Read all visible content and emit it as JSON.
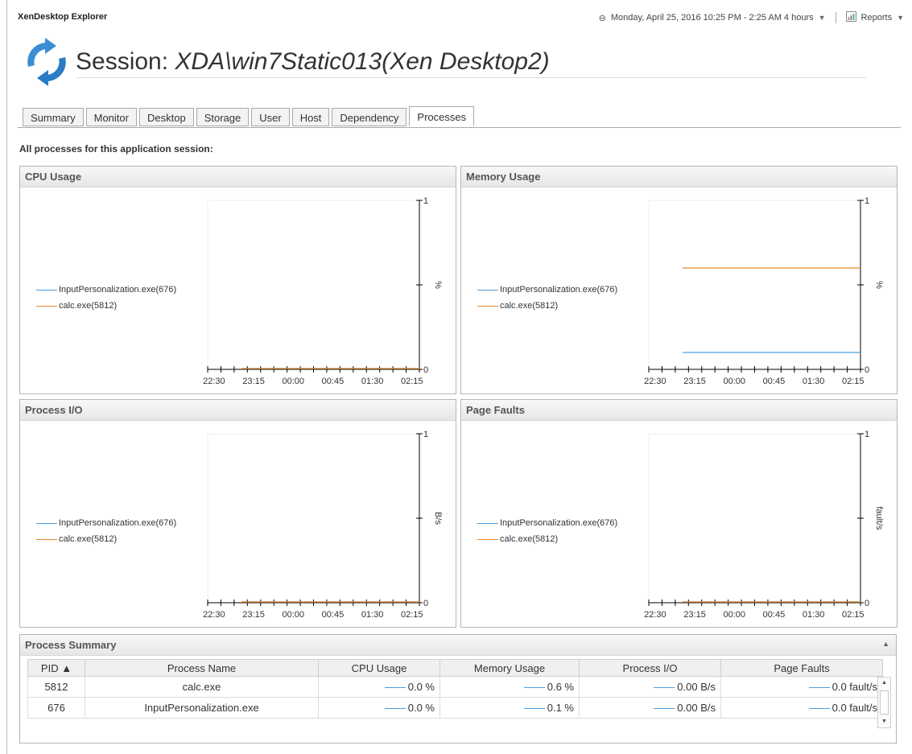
{
  "app": {
    "title": "XenDesktop Explorer"
  },
  "topbar": {
    "time_range": "Monday, April 25, 2016 10:25 PM - 2:25 AM 4 hours",
    "reports_label": "Reports"
  },
  "page": {
    "title_prefix": "Session: ",
    "title_name": "XDA\\win7Static013(Xen Desktop2)"
  },
  "tabs": [
    {
      "label": "Summary",
      "active": false
    },
    {
      "label": "Monitor",
      "active": false
    },
    {
      "label": "Desktop",
      "active": false
    },
    {
      "label": "Storage",
      "active": false
    },
    {
      "label": "User",
      "active": false
    },
    {
      "label": "Host",
      "active": false
    },
    {
      "label": "Dependency",
      "active": false
    },
    {
      "label": "Processes",
      "active": true
    }
  ],
  "section_label": "All processes for this application session:",
  "series_colors": {
    "input_personalization": "#4a9fe0",
    "calc": "#e8872a"
  },
  "chart_data": [
    {
      "type": "line",
      "title": "CPU Usage",
      "x_ticks": [
        "22:30",
        "23:15",
        "00:00",
        "00:45",
        "01:30",
        "02:15"
      ],
      "ylabel": "%",
      "ylim": [
        0,
        1
      ],
      "y_ticks": [
        "0",
        "1"
      ],
      "series": [
        {
          "name": "InputPersonalization.exe(676)",
          "color": "#4a9fe0",
          "values": [
            0,
            0
          ]
        },
        {
          "name": "calc.exe(5812)",
          "color": "#e8872a",
          "values": [
            0,
            0
          ]
        }
      ]
    },
    {
      "type": "line",
      "title": "Memory Usage",
      "x_ticks": [
        "22:30",
        "23:15",
        "00:00",
        "00:45",
        "01:30",
        "02:15"
      ],
      "ylabel": "%",
      "ylim": [
        0,
        1
      ],
      "y_ticks": [
        "0",
        "1"
      ],
      "series": [
        {
          "name": "InputPersonalization.exe(676)",
          "color": "#4a9fe0",
          "values": [
            0.1,
            0.1
          ]
        },
        {
          "name": "calc.exe(5812)",
          "color": "#e8872a",
          "values": [
            0.6,
            0.6
          ]
        }
      ]
    },
    {
      "type": "line",
      "title": "Process I/O",
      "x_ticks": [
        "22:30",
        "23:15",
        "00:00",
        "00:45",
        "01:30",
        "02:15"
      ],
      "ylabel": "B/s",
      "ylim": [
        0,
        1
      ],
      "y_ticks": [
        "0",
        "1"
      ],
      "series": [
        {
          "name": "InputPersonalization.exe(676)",
          "color": "#4a9fe0",
          "values": [
            0,
            0
          ]
        },
        {
          "name": "calc.exe(5812)",
          "color": "#e8872a",
          "values": [
            0,
            0
          ]
        }
      ]
    },
    {
      "type": "line",
      "title": "Page Faults",
      "x_ticks": [
        "22:30",
        "23:15",
        "00:00",
        "00:45",
        "01:30",
        "02:15"
      ],
      "ylabel": "fault/s",
      "ylim": [
        0,
        1
      ],
      "y_ticks": [
        "0",
        "1"
      ],
      "series": [
        {
          "name": "InputPersonalization.exe(676)",
          "color": "#4a9fe0",
          "values": [
            0,
            0
          ]
        },
        {
          "name": "calc.exe(5812)",
          "color": "#e8872a",
          "values": [
            0,
            0
          ]
        }
      ]
    }
  ],
  "summary": {
    "title": "Process Summary",
    "columns": [
      "PID ▲",
      "Process Name",
      "CPU Usage",
      "Memory Usage",
      "Process I/O",
      "Page Faults"
    ],
    "rows": [
      {
        "pid": "5812",
        "name": "calc.exe",
        "cpu": "0.0 %",
        "mem": "0.6 %",
        "io": "0.00 B/s",
        "faults": "0.0 fault/s"
      },
      {
        "pid": "676",
        "name": "InputPersonalization.exe",
        "cpu": "0.0 %",
        "mem": "0.1 %",
        "io": "0.00 B/s",
        "faults": "0.0 fault/s"
      }
    ]
  }
}
